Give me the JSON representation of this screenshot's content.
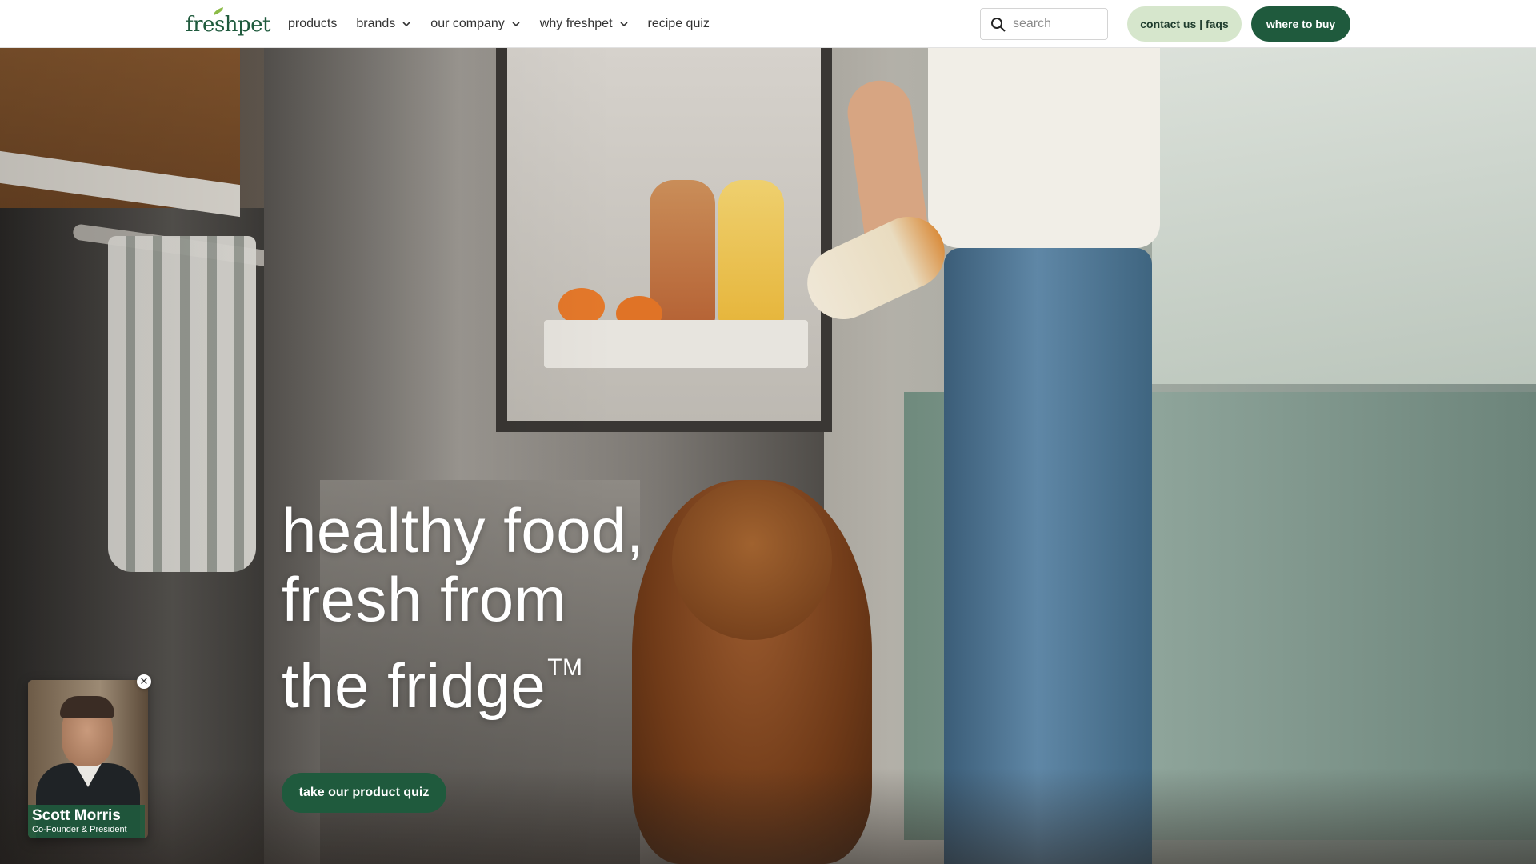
{
  "brand": {
    "logo_text": "freshpet",
    "color": "#1f5a3d"
  },
  "nav": {
    "items": [
      {
        "label": "products",
        "has_dropdown": false
      },
      {
        "label": "brands",
        "has_dropdown": true
      },
      {
        "label": "our company",
        "has_dropdown": true
      },
      {
        "label": "why freshpet",
        "has_dropdown": true
      },
      {
        "label": "recipe quiz",
        "has_dropdown": false
      }
    ]
  },
  "search": {
    "placeholder": "search",
    "value": ""
  },
  "header_buttons": {
    "contact_label": "contact us | faqs",
    "buy_label": "where to buy"
  },
  "hero": {
    "headline_lines": [
      "healthy food,",
      "fresh from",
      "the fridge"
    ],
    "trademark": "TM",
    "cta_label": "take our product quiz"
  },
  "video_bubble": {
    "name": "Scott Morris",
    "title": "Co-Founder & President",
    "close_symbol": "✕"
  },
  "colors": {
    "primary_green": "#1f5a3d",
    "light_green": "#d6e6cc",
    "nav_text": "#333333"
  }
}
